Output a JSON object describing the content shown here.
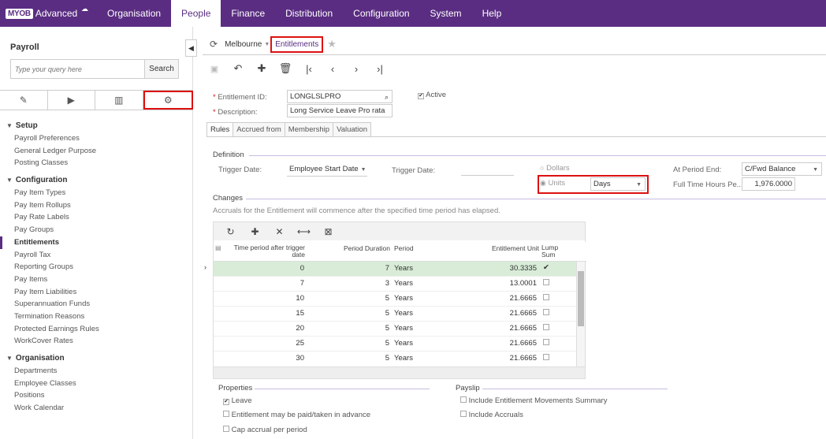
{
  "brand": {
    "logo": "MYOB",
    "product": "Advanced"
  },
  "topmenu": [
    "Organisation",
    "People",
    "Finance",
    "Distribution",
    "Configuration",
    "System",
    "Help"
  ],
  "topmenu_active": "People",
  "sidebar": {
    "title": "Payroll",
    "search_placeholder": "Type your query here",
    "search_button": "Search",
    "groups": [
      {
        "label": "Setup",
        "items": [
          "Payroll Preferences",
          "General Ledger Purpose",
          "Posting Classes"
        ]
      },
      {
        "label": "Configuration",
        "items": [
          "Pay Item Types",
          "Pay Item Rollups",
          "Pay Rate Labels",
          "Pay Groups",
          "Entitlements",
          "Payroll Tax",
          "Reporting Groups",
          "Pay Items",
          "Pay Item Liabilities",
          "Superannuation Funds",
          "Termination Reasons",
          "Protected Earnings Rules",
          "WorkCover Rates"
        ]
      },
      {
        "label": "Organisation",
        "items": [
          "Departments",
          "Employee Classes",
          "Positions",
          "Work Calendar"
        ]
      }
    ],
    "selected_item": "Entitlements"
  },
  "breadcrumb": {
    "location": "Melbourne",
    "screen": "Entitlements"
  },
  "form": {
    "entitlement_id_label": "Entitlement ID:",
    "entitlement_id": "LONGLSLPRO",
    "description_label": "Description:",
    "description": "Long Service Leave Pro rata",
    "active_label": "Active",
    "active": true
  },
  "subtabs": [
    "Rules",
    "Accrued from",
    "Membership",
    "Valuation"
  ],
  "definition": {
    "section": "Definition",
    "trigger_date_label": "Trigger Date:",
    "trigger_date_value": "Employee Start Date",
    "trigger_date2_label": "Trigger Date:",
    "dollars_label": "Dollars",
    "units_label": "Units",
    "units_value": "Days",
    "at_period_end_label": "At Period End:",
    "at_period_end_value": "C/Fwd Balance",
    "full_time_hours_label": "Full Time Hours Pe...",
    "full_time_hours_value": "1,976.0000"
  },
  "changes": {
    "section": "Changes",
    "note": "Accruals for the Entitlement will commence after the specified time period has elapsed.",
    "columns": [
      "Time period after trigger date",
      "Period Duration",
      "Period",
      "Entitlement Unit",
      "Lump Sum"
    ],
    "rows": [
      {
        "time": "0",
        "duration": "7",
        "period": "Years",
        "unit": "30.3335",
        "lump": true
      },
      {
        "time": "7",
        "duration": "3",
        "period": "Years",
        "unit": "13.0001",
        "lump": false
      },
      {
        "time": "10",
        "duration": "5",
        "period": "Years",
        "unit": "21.6665",
        "lump": false
      },
      {
        "time": "15",
        "duration": "5",
        "period": "Years",
        "unit": "21.6665",
        "lump": false
      },
      {
        "time": "20",
        "duration": "5",
        "period": "Years",
        "unit": "21.6665",
        "lump": false
      },
      {
        "time": "25",
        "duration": "5",
        "period": "Years",
        "unit": "21.6665",
        "lump": false
      },
      {
        "time": "30",
        "duration": "5",
        "period": "Years",
        "unit": "21.6665",
        "lump": false
      }
    ]
  },
  "properties": {
    "section": "Properties",
    "items": [
      {
        "label": "Leave",
        "checked": true
      },
      {
        "label": "Entitlement may be paid/taken in advance",
        "checked": false
      },
      {
        "label": "Cap accrual per period",
        "checked": false
      }
    ]
  },
  "payslip": {
    "section": "Payslip",
    "items": [
      {
        "label": "Include Entitlement Movements Summary",
        "checked": false
      },
      {
        "label": "Include Accruals",
        "checked": false
      }
    ]
  },
  "colors": {
    "brand": "#5a2d82",
    "highlight": "#dd1111",
    "row_selected": "#d8ecd8"
  }
}
